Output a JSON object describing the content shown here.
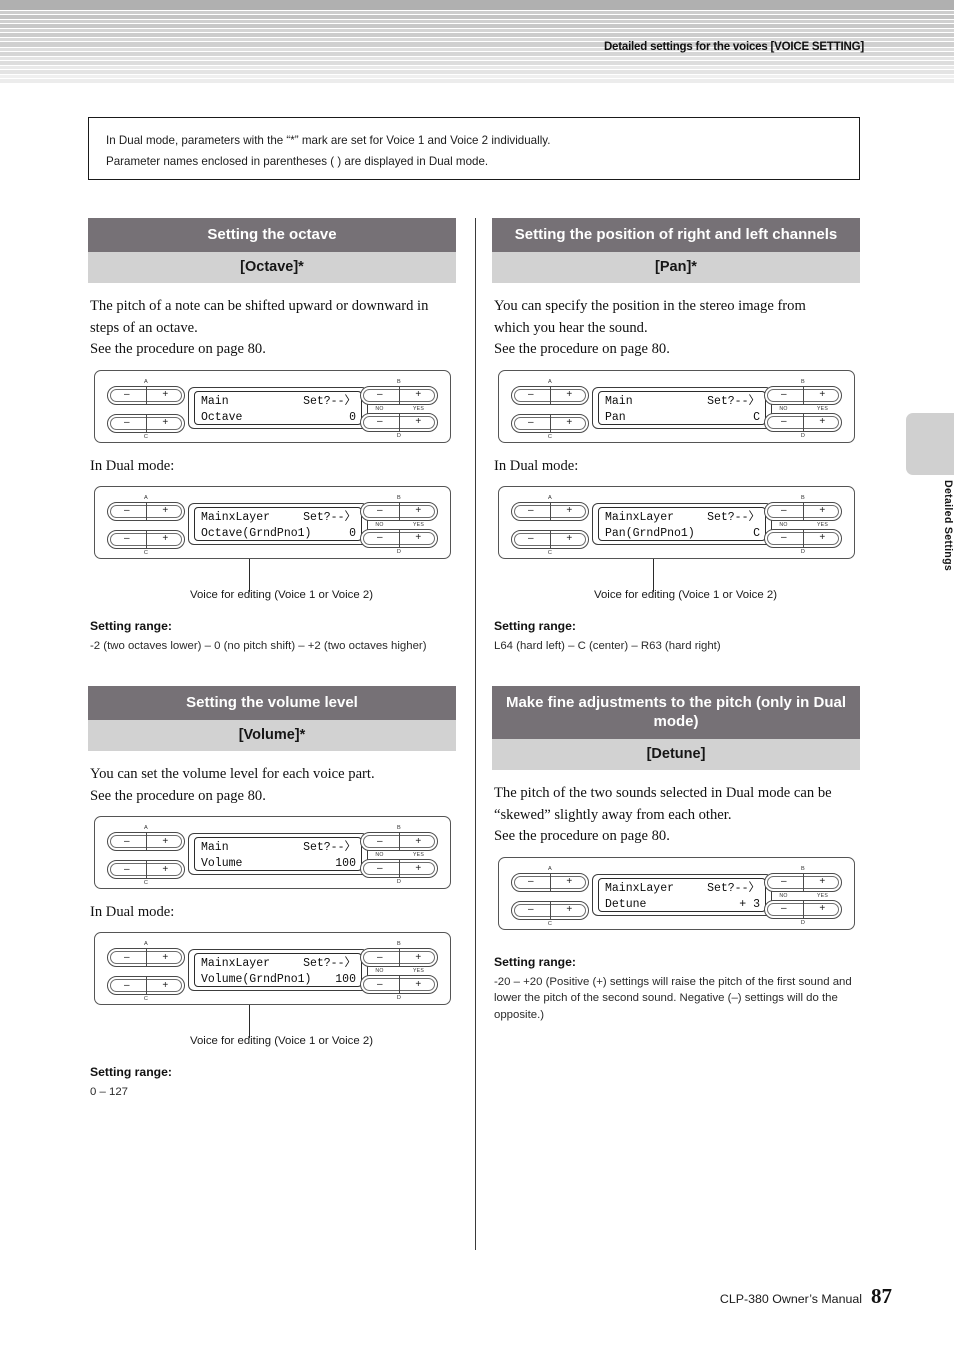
{
  "header": {
    "title": "Detailed settings for the voices [VOICE SETTING]"
  },
  "note_box": {
    "line1": "In Dual mode, parameters with the “*” mark are set for Voice 1 and Voice 2 individually.",
    "line2": "Parameter names enclosed in parentheses (  ) are displayed in Dual mode."
  },
  "side_tab": {
    "label": "Detailed Settings"
  },
  "footer": {
    "manual": "CLP-380 Owner’s Manual",
    "page": "87"
  },
  "common": {
    "in_dual_mode": "In Dual mode:",
    "setting_range_label": "Setting range:",
    "pointer_caption": "Voice for editing (Voice 1 or Voice 2)",
    "btn_minus": "–",
    "btn_plus": "+",
    "letter_a": "A",
    "letter_b": "B",
    "letter_c": "C",
    "letter_d": "D",
    "label_no": "NO",
    "label_yes": "YES"
  },
  "sections": {
    "octave": {
      "title": "Setting the octave",
      "subtitle": "[Octave]*",
      "body": [
        "The pitch of a note can be shifted upward or downward in",
        "steps of an octave.",
        "See the procedure on page 80."
      ],
      "panel_main": {
        "line1_left": "Main",
        "line1_right": "Set?--〉",
        "line2_left": "Octave",
        "line2_right": "0"
      },
      "panel_dual": {
        "line1_left": "MainxLayer",
        "line1_right": "Set?--〉",
        "line2_left": "Octave(GrndPno1)",
        "line2_right": "0"
      },
      "range": "-2 (two octaves lower) – 0 (no pitch shift) – +2 (two octaves higher)"
    },
    "volume": {
      "title": "Setting the volume level",
      "subtitle": "[Volume]*",
      "body": [
        "You can set the volume level for each voice part.",
        "See the procedure on page 80."
      ],
      "panel_main": {
        "line1_left": "Main",
        "line1_right": "Set?--〉",
        "line2_left": "Volume",
        "line2_right": "100"
      },
      "panel_dual": {
        "line1_left": "MainxLayer",
        "line1_right": "Set?--〉",
        "line2_left": "Volume(GrndPno1)",
        "line2_right": "100"
      },
      "range": "0 – 127"
    },
    "pan": {
      "title": "Setting the position of right and left channels",
      "subtitle": "[Pan]*",
      "body": [
        "You can specify the position in the stereo image from",
        "which you hear the sound.",
        "See the procedure on page 80."
      ],
      "panel_main": {
        "line1_left": "Main",
        "line1_right": "Set?--〉",
        "line2_left": "Pan",
        "line2_right": "C"
      },
      "panel_dual": {
        "line1_left": "MainxLayer",
        "line1_right": "Set?--〉",
        "line2_left": "Pan(GrndPno1)",
        "line2_right": "C"
      },
      "range": "L64 (hard left) – C (center) – R63 (hard right)"
    },
    "detune": {
      "title": "Make fine adjustments to the pitch (only in Dual mode)",
      "subtitle": "[Detune]",
      "body": [
        "The pitch of the two sounds selected in Dual mode can be",
        "“skewed” slightly away from each other.",
        "See the procedure on page 80."
      ],
      "panel_main": {
        "line1_left": "MainxLayer",
        "line1_right": "Set?--〉",
        "line2_left": "Detune",
        "line2_right": "+ 3"
      },
      "range": "-20 – +20 (Positive (+) settings will raise the pitch of the first sound and lower the pitch of the second sound. Negative (–) settings will do the opposite.)"
    }
  }
}
